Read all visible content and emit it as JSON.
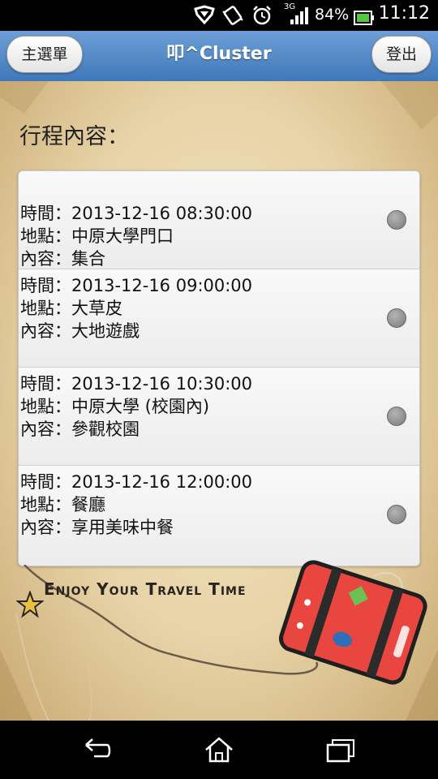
{
  "status_bar": {
    "network": "3G",
    "battery_percent": "84%",
    "time": "11:12"
  },
  "header": {
    "menu_label": "主選單",
    "title": "叩^Cluster",
    "logout_label": "登出"
  },
  "section": {
    "title": "行程內容："
  },
  "schedule": [
    {
      "time": "時間：2013-12-16  08:30:00",
      "place": "地點：中原大學門口",
      "content": "內容：集合"
    },
    {
      "time": "時間：2013-12-16  09:00:00",
      "place": "地點：大草皮",
      "content": "內容：大地遊戲"
    },
    {
      "time": "時間：2013-12-16  10:30:00",
      "place": "地點：中原大學 (校園內)",
      "content": "內容：參觀校園"
    },
    {
      "time": "時間：2013-12-16  12:00:00",
      "place": "地點：餐廳",
      "content": "內容：享用美味中餐"
    }
  ],
  "decoration": {
    "slogan": "Enjoy Your Travel Time"
  },
  "colors": {
    "header_top": "#6d9fd6",
    "header_bottom": "#3f78ba",
    "suitcase": "#e8463f"
  },
  "icons": {
    "nav": [
      "back-icon",
      "home-icon",
      "recent-apps-icon"
    ],
    "status": [
      "shield-icon",
      "vibrate-icon",
      "alarm-icon",
      "signal-icon",
      "battery-icon"
    ]
  }
}
